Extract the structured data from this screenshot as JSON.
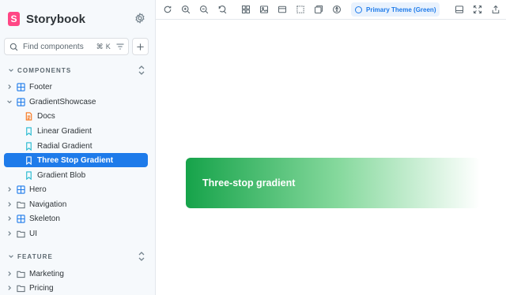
{
  "app": {
    "name": "Storybook",
    "logo_letter": "S",
    "brand_color": "#ff4785",
    "accent_color": "#1e7bea"
  },
  "search": {
    "placeholder": "Find components",
    "shortcut": "⌘ K"
  },
  "sections": [
    {
      "title": "COMPONENTS"
    },
    {
      "title": "FEATURE"
    }
  ],
  "tree": {
    "footer": "Footer",
    "gradient_showcase": "GradientShowcase",
    "docs": "Docs",
    "linear": "Linear Gradient",
    "radial": "Radial Gradient",
    "three_stop": "Three Stop Gradient",
    "blob": "Gradient Blob",
    "hero": "Hero",
    "navigation": "Navigation",
    "skeleton": "Skeleton",
    "ui": "UI",
    "marketing": "Marketing",
    "pricing": "Pricing"
  },
  "toolbar": {
    "theme_label": "Primary Theme (Green)"
  },
  "canvas": {
    "card_text": "Three-stop gradient",
    "gradient_colors": [
      "#16a34a",
      "#86d99d",
      "#ffffff"
    ]
  }
}
